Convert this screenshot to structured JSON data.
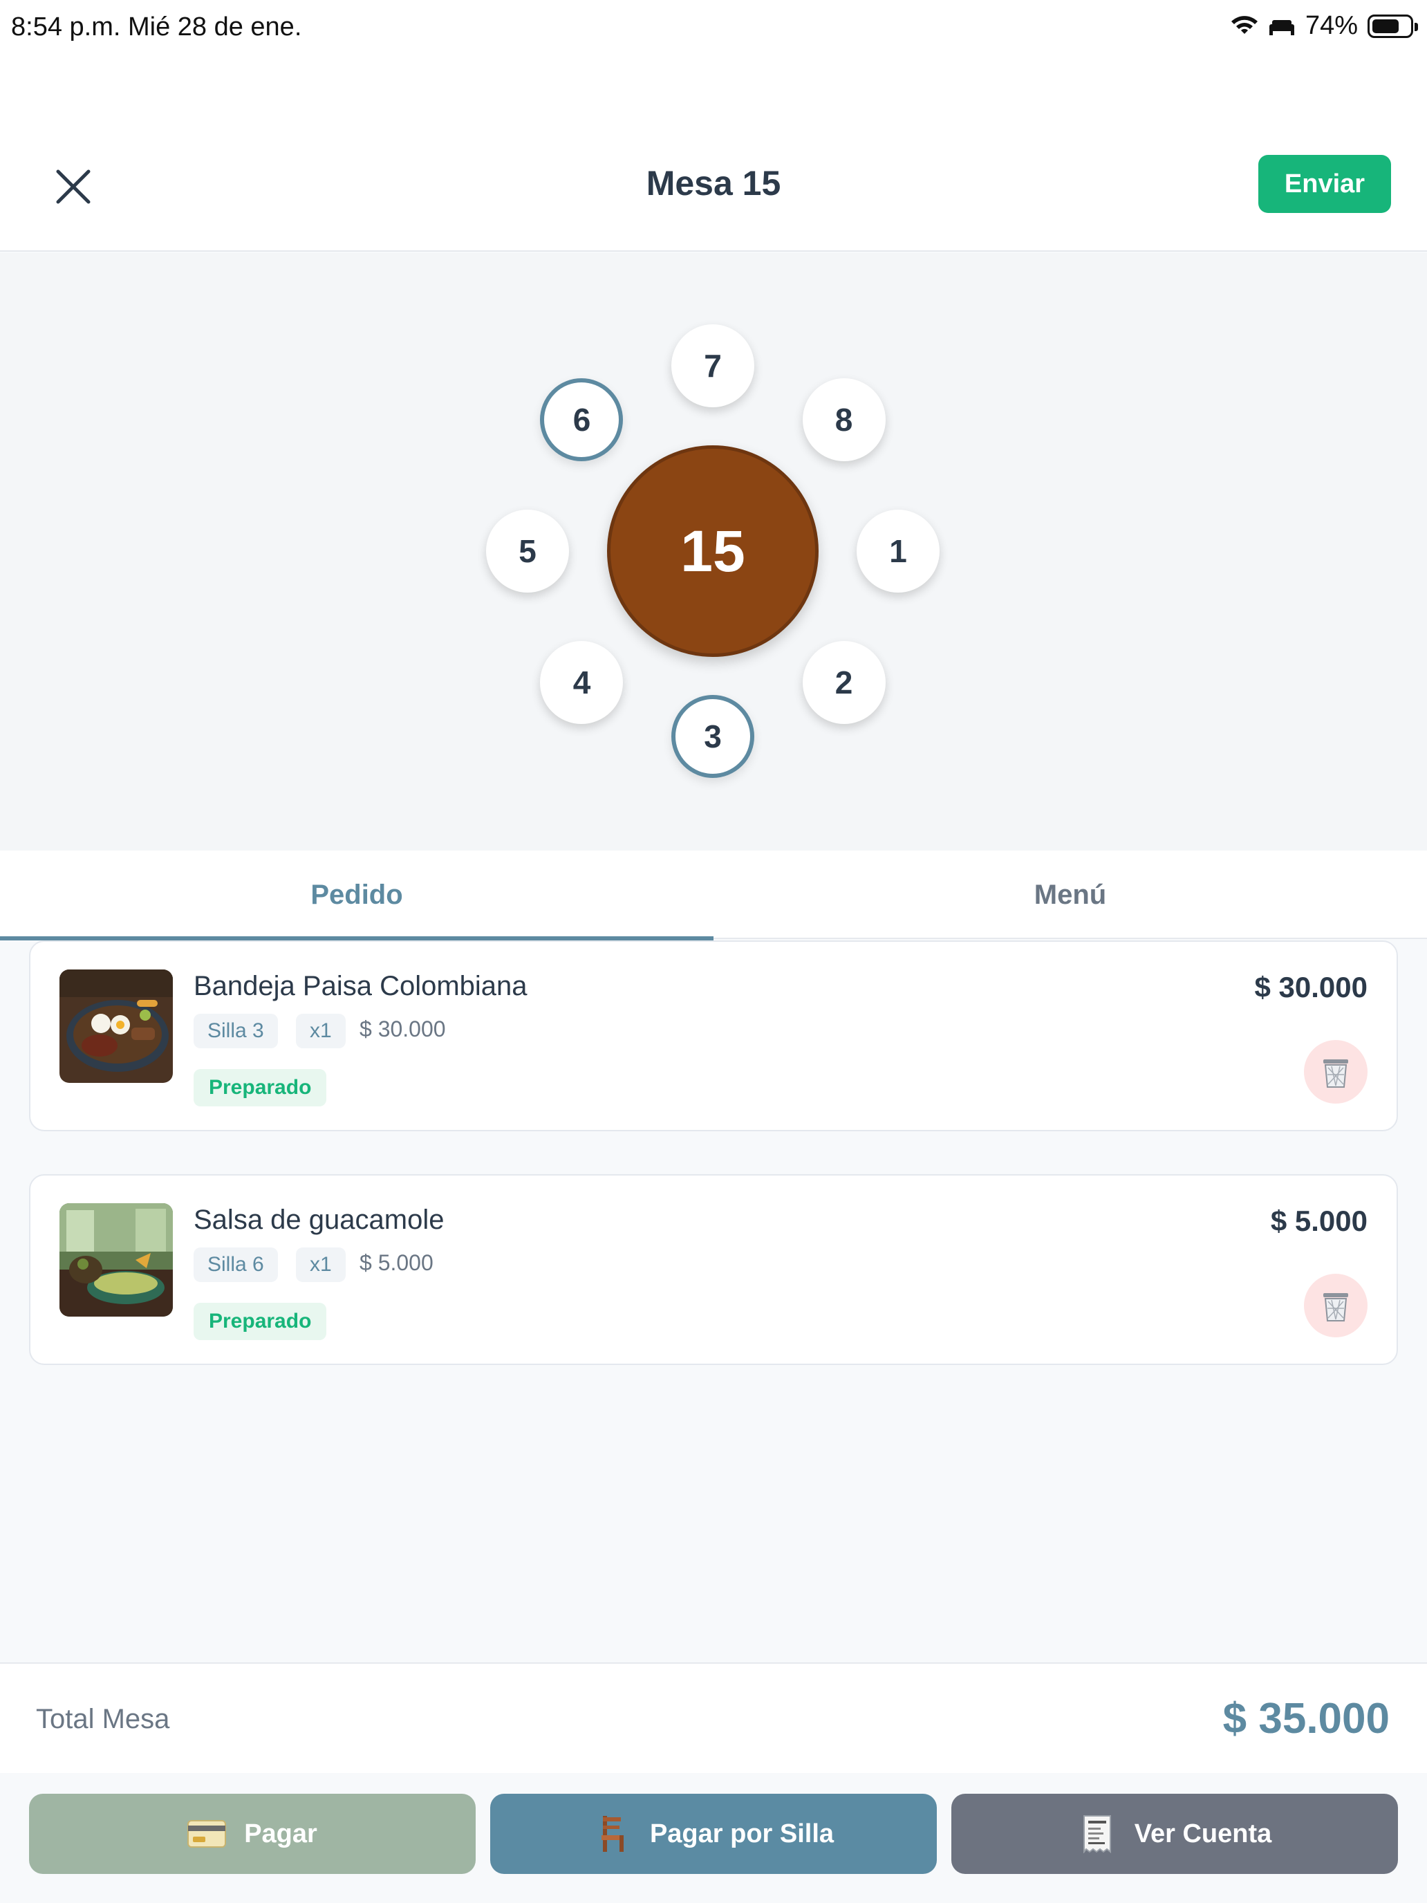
{
  "status_bar": {
    "time": "8:54 p.m.   Mié 28 de ene.",
    "battery": "74%",
    "battery_level": 0.74
  },
  "header": {
    "title": "Mesa 15",
    "send_label": "Enviar",
    "close_icon": "close-icon"
  },
  "table": {
    "number": "15",
    "seats": [
      {
        "label": "7",
        "active": false
      },
      {
        "label": "8",
        "active": false
      },
      {
        "label": "1",
        "active": false
      },
      {
        "label": "2",
        "active": false
      },
      {
        "label": "3",
        "active": true
      },
      {
        "label": "4",
        "active": false
      },
      {
        "label": "5",
        "active": false
      },
      {
        "label": "6",
        "active": true
      }
    ]
  },
  "tabs": [
    {
      "label": "Pedido",
      "active": true
    },
    {
      "label": "Menú",
      "active": false
    }
  ],
  "order_items": [
    {
      "name": "Bandeja Paisa Colombiana",
      "seat": "Silla 3",
      "qty": "x1",
      "unit_price": "$ 30.000",
      "status": "Preparado",
      "total": "$ 30.000"
    },
    {
      "name": "Salsa de guacamole",
      "seat": "Silla 6",
      "qty": "x1",
      "unit_price": "$ 5.000",
      "status": "Preparado",
      "total": "$ 5.000"
    }
  ],
  "totals": {
    "label": "Total Mesa",
    "value": "$ 35.000"
  },
  "actions": [
    {
      "label": "Pagar",
      "icon": "credit-card-icon",
      "color": "#9fb5a3"
    },
    {
      "label": "Pagar por Silla",
      "icon": "chair-icon",
      "color": "#5b8ba3"
    },
    {
      "label": "Ver Cuenta",
      "icon": "receipt-icon",
      "color": "#6d7380"
    }
  ],
  "colors": {
    "accent": "#5d8aa1",
    "success": "#17b57a",
    "table": "#8b4513",
    "danger_bg": "#fde3e3"
  }
}
